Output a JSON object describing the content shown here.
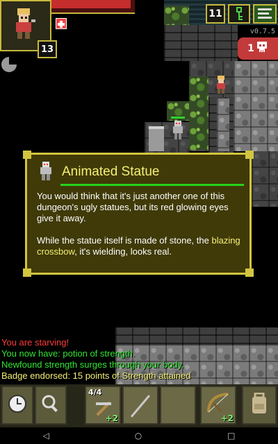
{
  "hud": {
    "level": "13",
    "hp_fraction": 0.95,
    "depth": "11",
    "version": "v0.7.5",
    "danger_count": "1",
    "icons": {
      "hero": "warrior-portrait",
      "buff": "hunger-status-icon",
      "busy": "wait-dial-icon",
      "keys": "iron-key-icon",
      "journal": "journal-icon",
      "danger": "skull-icon"
    }
  },
  "info_window": {
    "title": "Animated Statue",
    "icon": "statue-icon",
    "para1": "You would think that it's just another one of this dungeon's ugly statues, but its red glowing eyes give it away.",
    "para2_before": "While the statue itself is made of stone, the ",
    "para2_highlight": "blazing crossbow",
    "para2_after": ", it's wielding, looks real."
  },
  "log": [
    {
      "text": "You are starving!",
      "color": "#ff3b3b"
    },
    {
      "text": "You now have: potion of strength.",
      "color": "#33e533"
    },
    {
      "text": "Newfound strength surges through your body.",
      "color": "#33e533"
    },
    {
      "text": "Badge endorsed: 15 points of Strength attained",
      "color": "#f4f076"
    }
  ],
  "toolbar": {
    "wait_icon": "clock-icon",
    "search_icon": "magnifier-icon",
    "inventory_icon": "backpack-icon",
    "quickslots": [
      {
        "icon": "pickaxe-icon",
        "top": "4/4",
        "count": "+2"
      },
      {
        "icon": "spear-icon",
        "top": "",
        "count": ""
      },
      {
        "icon": "empty-slot",
        "top": "",
        "count": ""
      },
      {
        "icon": "crossbow-icon",
        "top": "",
        "count": "+2"
      }
    ]
  },
  "navbar": {
    "back": "◁",
    "home": "○",
    "recent": "□"
  },
  "colors": {
    "frame": "#c8b83c",
    "window_bg": "#403a08",
    "title": "#f4f076",
    "rule": "#27d31b"
  }
}
